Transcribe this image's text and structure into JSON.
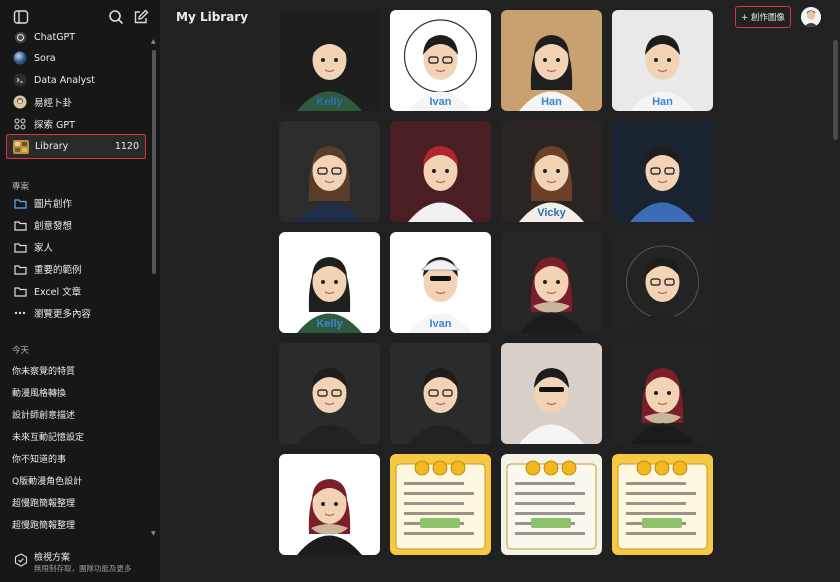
{
  "sidebar": {
    "items": [
      {
        "label": "ChatGPT",
        "icon": "chatgpt-icon"
      },
      {
        "label": "Sora",
        "icon": "sora-icon"
      },
      {
        "label": "Data Analyst",
        "icon": "data-analyst-icon"
      },
      {
        "label": "易經卜卦",
        "icon": "gpt-avatar-icon"
      },
      {
        "label": "探索 GPT",
        "icon": "grid-icon"
      },
      {
        "label": "Library",
        "count": "1120",
        "icon": "library-thumb-icon"
      }
    ],
    "projects_label": "專案",
    "projects": [
      {
        "label": "圖片創作"
      },
      {
        "label": "創意發想"
      },
      {
        "label": "家人"
      },
      {
        "label": "重要的範例"
      },
      {
        "label": "Excel 文章"
      }
    ],
    "more_label": "瀏覽更多內容",
    "today_label": "今天",
    "history": [
      "你未察覺的特質",
      "動漫風格轉換",
      "設計師創意描述",
      "未來互動記憶設定",
      "你不知道的事",
      "Q版動漫角色設計",
      "超慢跑簡報整理",
      "超慢跑簡報整理"
    ],
    "footer": {
      "title": "檢視方案",
      "subtitle": "無限制存取，團隊功能及更多"
    }
  },
  "header": {
    "title": "My Library",
    "create_label": "+ 創作圖像"
  },
  "tiles": [
    {
      "caption": "Kelly"
    },
    {
      "caption": "Ivan"
    },
    {
      "caption": "Han"
    },
    {
      "caption": "Han"
    },
    {
      "caption": ""
    },
    {
      "caption": ""
    },
    {
      "caption": "Vicky"
    },
    {
      "caption": ""
    },
    {
      "caption": "Kelly"
    },
    {
      "caption": "Ivan"
    },
    {
      "caption": ""
    },
    {
      "caption": ""
    },
    {
      "caption": ""
    },
    {
      "caption": ""
    },
    {
      "caption": ""
    },
    {
      "caption": ""
    },
    {
      "caption": ""
    },
    {
      "caption": ""
    },
    {
      "caption": ""
    },
    {
      "caption": ""
    }
  ]
}
